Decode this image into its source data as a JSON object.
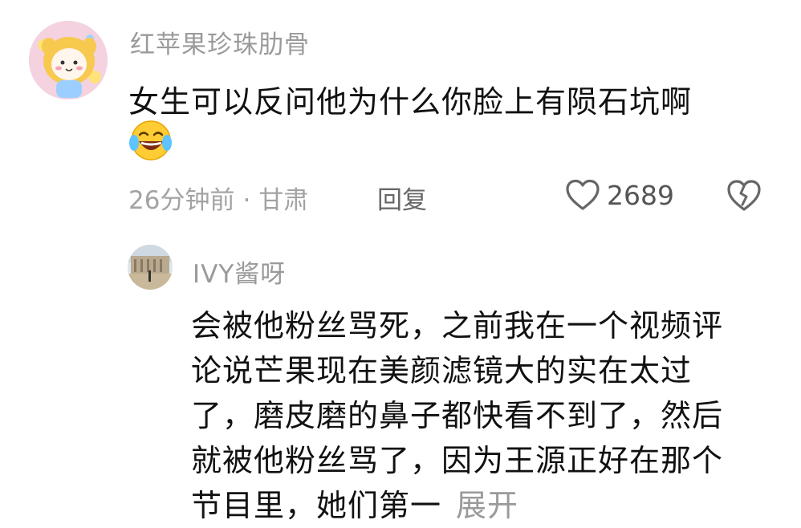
{
  "comment": {
    "username": "红苹果珍珠肋骨",
    "text": "女生可以反问他为什么你脸上有陨石坑啊",
    "emoji_icon": "laughing-crying-emoji",
    "time": "26分钟前",
    "separator": "·",
    "location": "甘肃",
    "reply_label": "回复",
    "like_count": "2689",
    "like_icon": "heart-outline-icon",
    "dislike_icon": "broken-heart-icon"
  },
  "reply": {
    "username": "IVY酱呀",
    "lines": [
      "会被他粉丝骂死，之前我在一个视频评",
      "论说芒果现在美颜滤镜大的实在太过",
      "了，磨皮磨的鼻子都快看不到了，然后",
      "就被他粉丝骂了，因为王源正好在那个",
      "节目里，她们第一"
    ],
    "expand_label": "展开"
  },
  "colors": {
    "text_primary": "#111111",
    "text_secondary": "#9a9a9a",
    "icon_gray": "#666666",
    "background": "#ffffff"
  }
}
